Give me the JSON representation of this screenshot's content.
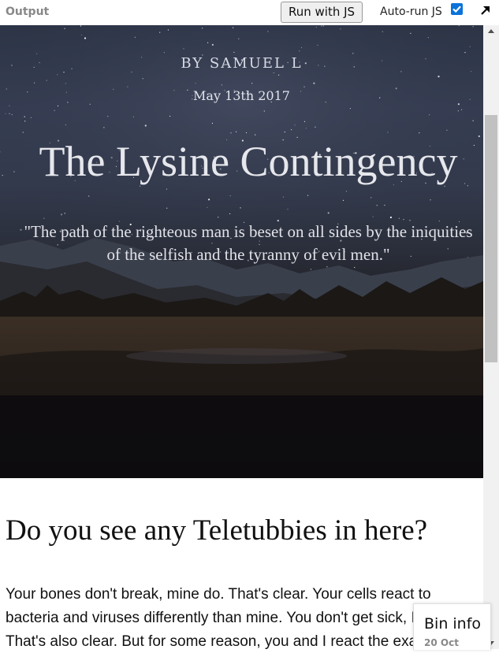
{
  "toolbar": {
    "output_label": "Output",
    "run_label": "Run with JS",
    "autorun_label": "Auto-run JS",
    "autorun_checked": true,
    "expand_icon": "arrow-up-right-icon"
  },
  "article": {
    "byline": "BY SAMUEL L",
    "date": "May 13th 2017",
    "title": "The Lysine Contingency",
    "quote": "\"The path of the righteous man is beset on all sides by the iniquities of the selfish and the tyranny of evil men.\"",
    "heading": "Do you see any Teletubbies in here?",
    "paragraph": "Your bones don't break, mine do. That's clear. Your cells react to bacteria and viruses differently than mine. You don't get sick, I do. That's also clear. But for some reason, you and I react the exact same way to water."
  },
  "bin_info": {
    "title": "Bin info",
    "date": "20 Oct"
  },
  "colors": {
    "checkbox_accent": "#0b73d9",
    "hero_sky": "#333a4c",
    "hero_ground": "#121012"
  }
}
